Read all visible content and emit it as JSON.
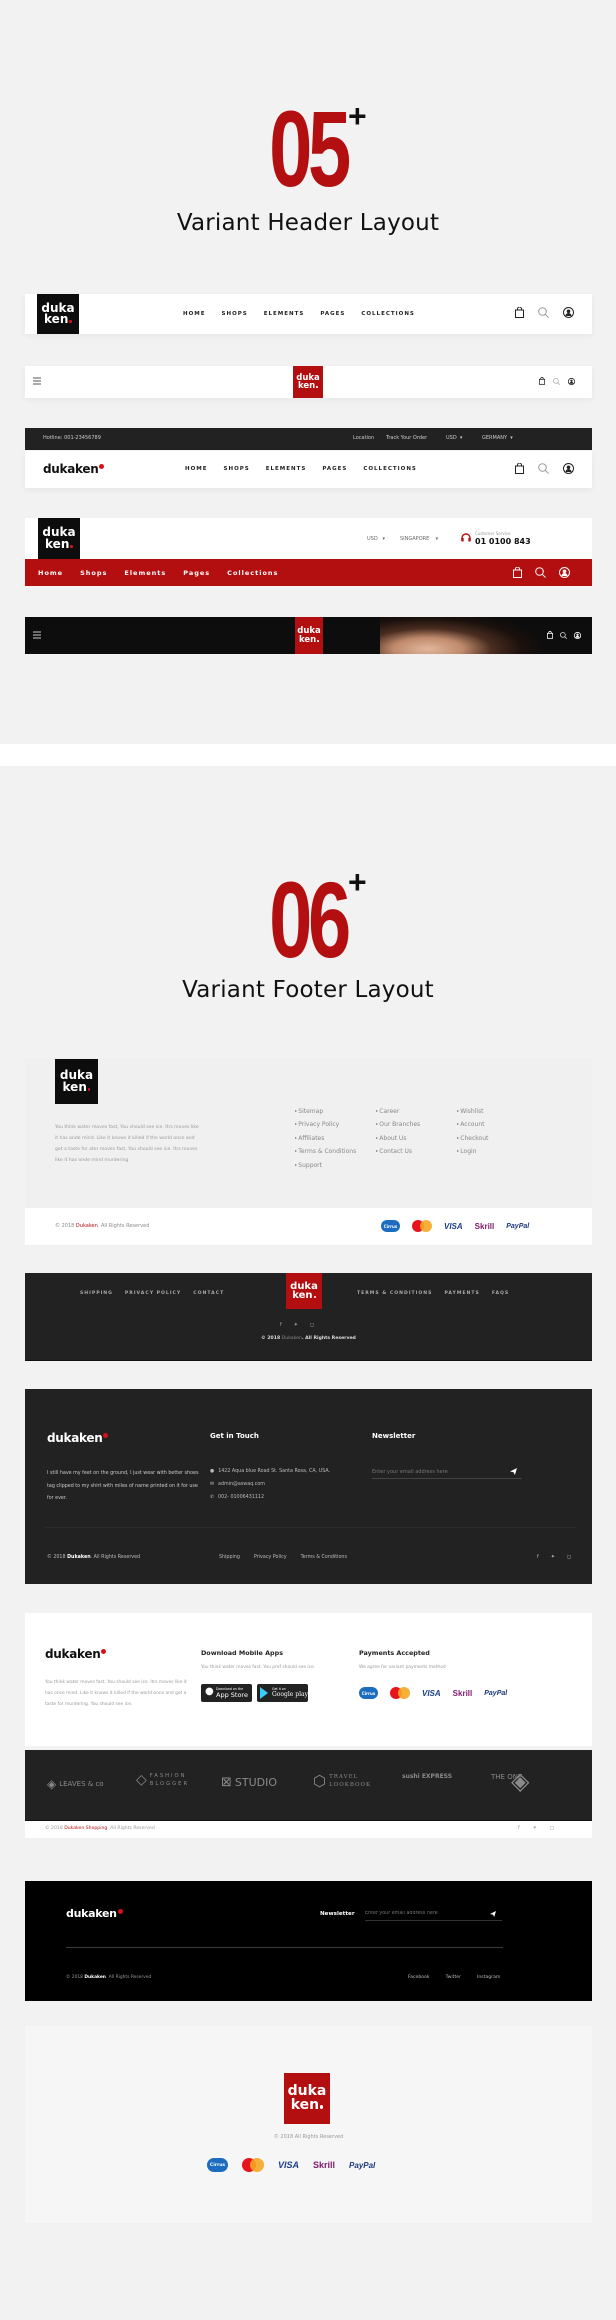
{
  "colors": {
    "brand_red": "#b30f10",
    "dark": "#222222",
    "black": "#0d0d0d",
    "page_bg": "#f2f2f2"
  },
  "brand": {
    "logo_top": "duka",
    "logo_bottom": "ken",
    "wordmark": "dukaken"
  },
  "header_section": {
    "number": "05",
    "plus": "+",
    "subtitle": "Variant Header Layout"
  },
  "headers": {
    "h1": {
      "nav": [
        "HOME",
        "SHOPS",
        "ELEMENTS",
        "PAGES",
        "COLLECTIONS"
      ],
      "icons": [
        "cart-icon",
        "search-icon",
        "user-icon"
      ]
    },
    "h2": {
      "icons": [
        "menu-icon",
        "cart-icon",
        "search-icon",
        "user-icon"
      ]
    },
    "h3": {
      "hotline": "Hotline: 001-23456789",
      "location": "Location",
      "track": "Track Your Order",
      "currency": "USD",
      "country": "GERMANY",
      "nav": [
        "HOME",
        "SHOPS",
        "ELEMENTS",
        "PAGES",
        "COLLECTIONS"
      ]
    },
    "h4": {
      "currency": "USD",
      "country": "SINGAPORE",
      "service_label": "Customer Service",
      "service_phone": "01 0100 843",
      "nav": [
        "Home",
        "Shops",
        "Elements",
        "Pages",
        "Collections"
      ]
    },
    "h5": {
      "icons": [
        "menu-icon",
        "cart-icon",
        "search-icon",
        "user-icon"
      ]
    }
  },
  "footer_section": {
    "number": "06",
    "plus": "+",
    "subtitle": "Variant Footer Layout"
  },
  "footers": {
    "f1": {
      "about": "You think water moves fast, You should see ice. Itrs moves like it has onde mind. Like it knows it killed if the world once and got a taste for ater moves fast, You should see ice. Itrs moves like it has onde mind murdering",
      "col1": [
        "Sitemap",
        "Privacy Policy",
        "Affiliates",
        "Terms & Conditions",
        "Support"
      ],
      "col2": [
        "Career",
        "Our Branches",
        "About Us",
        "Contact Us"
      ],
      "col3": [
        "Wishlist",
        "Account",
        "Checkout",
        "Login"
      ],
      "copy_prefix": "© 2018",
      "copy_brand": "Dukaken",
      "copy_suffix": ". All Rights Reserved",
      "payments": [
        "Cirrus",
        "MasterCard",
        "VISA",
        "Skrill",
        "PayPal"
      ]
    },
    "f2": {
      "left_links": [
        "SHIPPING",
        "PRIVACY POLICY",
        "CONTACT"
      ],
      "right_links": [
        "TERMS & CONDITIONS",
        "PAYMENTS",
        "FAQS"
      ],
      "social": [
        "f",
        "t",
        "ig"
      ],
      "copy_prefix": "© 2018",
      "copy_brand": "Dukaken",
      "copy_suffix": ". All Rights Reserved"
    },
    "f3": {
      "about": "I still have my feet on the ground, I just wear with better shoes tag clipped to my shirt with miles of name printed on it for use for ever.",
      "contact_title": "Get in Touch",
      "address": "1422 Aqua blue Road St. Santa Rosa, CA, USA.",
      "email": "admin@aswaq.com",
      "phone": "002- 01006431112",
      "newsletter_title": "Newsletter",
      "newsletter_placeholder": "Enter your email address here",
      "copy_prefix": "© 2018",
      "copy_brand": "Dukaken",
      "copy_suffix": ". All Rights Reserved",
      "bottom_links": [
        "Shipping",
        "Privacy Policy",
        "Terms & Conditions"
      ],
      "social": [
        "f",
        "t",
        "ig"
      ]
    },
    "f4": {
      "about": "You think water moves fast, You should see ice. Itrs moves like it has once mind. Like it knows it killed if the world once and got a taste for murdering. You should see ice.",
      "apps_title": "Download Mobile Apps",
      "apps_desc": "You think water moves fast. You pref should see ice.",
      "appstore_small": "Download on the",
      "appstore_big": "App Store",
      "gplay_small": "Get it on",
      "gplay_big": "Google play",
      "payments_title": "Payments Accepted",
      "payments_desc": "We agree for variant payments method",
      "payments": [
        "Cirrus",
        "MasterCard",
        "VISA",
        "Skrill",
        "PayPal"
      ],
      "brands": [
        "LEAVES & co",
        "FASHION BLOGGER",
        "STUDIO",
        "TRAVEL LOOKBOOK",
        "sushi EXPRESS",
        "THE ONE"
      ],
      "copy_prefix": "© 2018",
      "copy_brand": "Dukaken Shopping",
      "copy_suffix": ". All Rights Reserved",
      "social": [
        "f",
        "t",
        "ig"
      ]
    },
    "f5": {
      "newsletter_title": "Newsletter",
      "newsletter_placeholder": "Enter your email address here",
      "copy_prefix": "© 2018",
      "copy_brand": "Dukaken",
      "copy_suffix": ". All Rights Reserved",
      "social_links": [
        "Facebook",
        "Twitter",
        "Instagram"
      ]
    },
    "f6": {
      "copy": "© 2018 All Rights Reserved",
      "payments": [
        "Cirrus",
        "MasterCard",
        "VISA",
        "Skrill",
        "PayPal"
      ]
    }
  }
}
